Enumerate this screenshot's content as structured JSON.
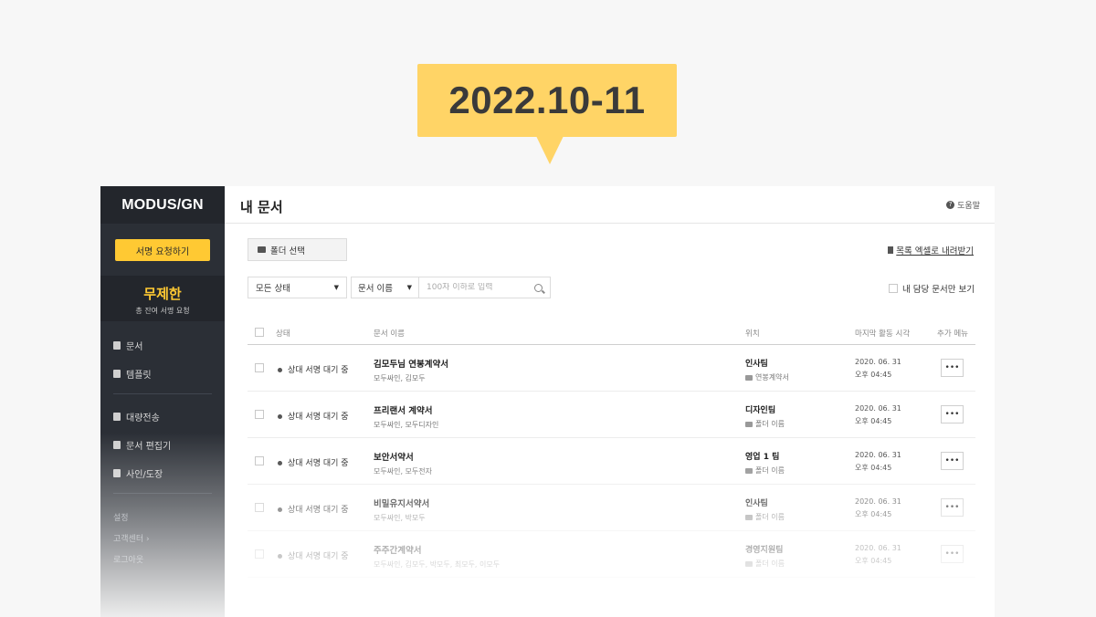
{
  "banner": {
    "text": "2022.10-11"
  },
  "sidebar": {
    "logo": "MODUS/GN",
    "sign_request_label": "서명 요청하기",
    "quota": {
      "value": "무제한",
      "label": "총 잔여 서명 요청"
    },
    "items": [
      {
        "label": "문서"
      },
      {
        "label": "템플릿"
      },
      {
        "label": "대량전송"
      },
      {
        "label": "문서 편집기"
      },
      {
        "label": "사인/도장"
      }
    ],
    "settings_label": "설정",
    "support_label": "고객센터",
    "logout_label": "로그아웃"
  },
  "header": {
    "title": "내 문서",
    "help_label": "도움말"
  },
  "toolbar": {
    "folder_select_label": "폴더 선택",
    "download_label": "목록 엑셀로 내려받기",
    "status_filter": "모든 상태",
    "field_filter": "문서 이름",
    "search_placeholder": "100자 이하로 입력",
    "mine_only_label": "내 담당 문서만 보기"
  },
  "table": {
    "columns": {
      "status": "상태",
      "name": "문서 이름",
      "location": "위치",
      "last_activity": "마지막 활동 시각",
      "more": "추가 메뉴"
    },
    "rows": [
      {
        "status": "상대 서명 대기 중",
        "name": "김모두님 연봉계약서",
        "parties": "모두싸인, 김모두",
        "team": "인사팀",
        "folder": "연봉계약서",
        "date": "2020. 06. 31",
        "time": "오후 04:45"
      },
      {
        "status": "상대 서명 대기 중",
        "name": "프리랜서 계약서",
        "parties": "모두싸인, 모두디자인",
        "team": "디자인팀",
        "folder": "폴더 이름",
        "date": "2020. 06. 31",
        "time": "오후 04:45"
      },
      {
        "status": "상대 서명 대기 중",
        "name": "보안서약서",
        "parties": "모두싸인, 모두전자",
        "team": "영업 1 팀",
        "folder": "폴더 이름",
        "date": "2020. 06. 31",
        "time": "오후 04:45"
      },
      {
        "status": "상대 서명 대기 중",
        "name": "비밀유지서약서",
        "parties": "모두싸인, 박모두",
        "team": "인사팀",
        "folder": "폴더 이름",
        "date": "2020. 06. 31",
        "time": "오후 04:45"
      },
      {
        "status": "상대 서명 대기 중",
        "name": "주주간계약서",
        "parties": "모두싸인, 김모두, 박모두, 최모두, 이모두",
        "team": "경영지원팀",
        "folder": "폴더 이름",
        "date": "2020. 06. 31",
        "time": "오후 04:45"
      }
    ],
    "more_label": "•••"
  }
}
